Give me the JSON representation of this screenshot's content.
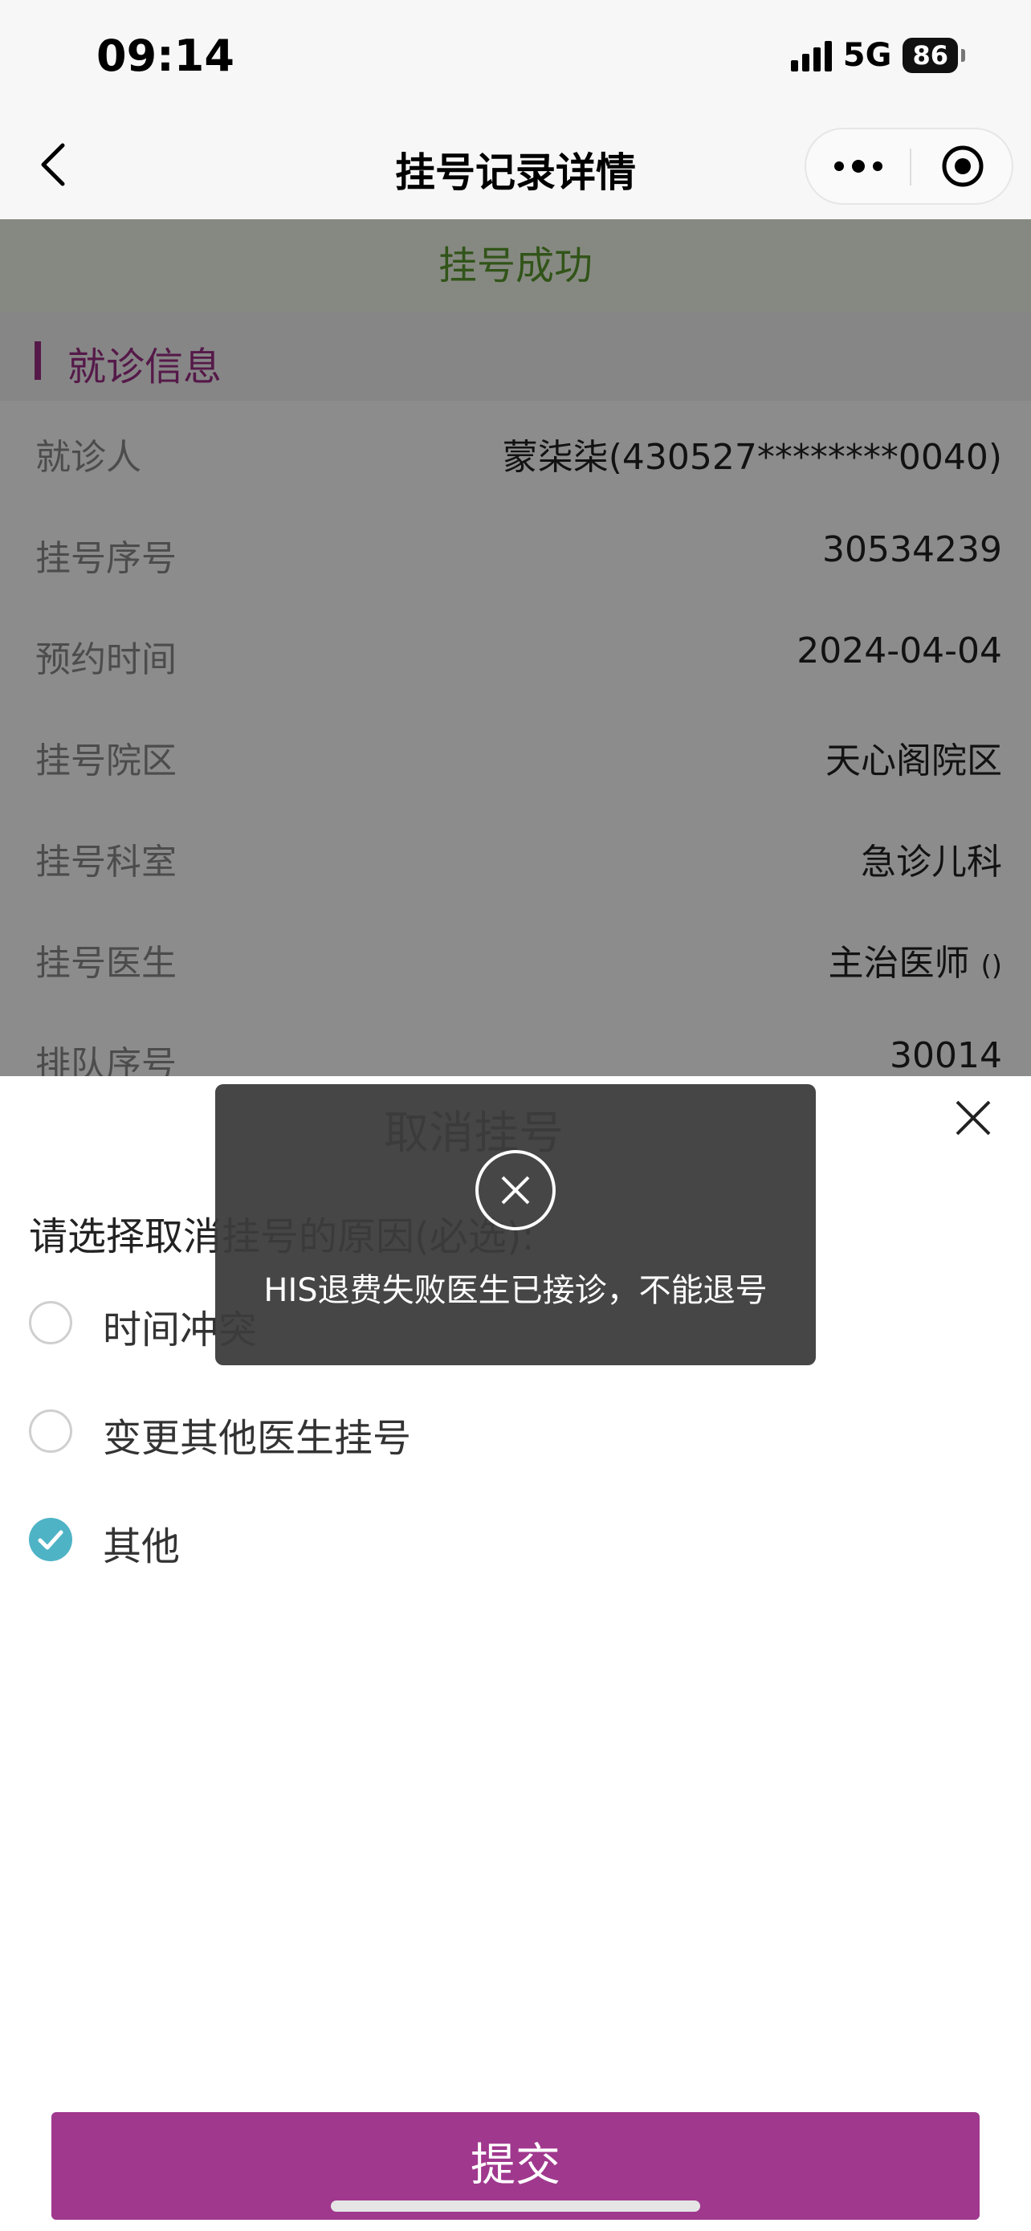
{
  "status_bar": {
    "time": "09:14",
    "network": "5G",
    "battery": "86"
  },
  "nav": {
    "title": "挂号记录详情"
  },
  "detail": {
    "status": "挂号成功",
    "section_title": "就诊信息",
    "rows": [
      {
        "label": "就诊人",
        "value": "蒙柒柒(430527********0040)"
      },
      {
        "label": "挂号序号",
        "value": "30534239"
      },
      {
        "label": "预约时间",
        "value": "2024-04-04"
      },
      {
        "label": "挂号院区",
        "value": "天心阁院区"
      },
      {
        "label": "挂号科室",
        "value": "急诊儿科"
      },
      {
        "label": "挂号医生",
        "value": "主治医师",
        "extra": "()"
      },
      {
        "label": "排队序号",
        "value": "30014"
      }
    ]
  },
  "cancel_sheet": {
    "title": "取消挂号",
    "reason_label": "请选择取消挂号的原因(必选):",
    "options": [
      {
        "label": "时间冲突",
        "checked": false
      },
      {
        "label": "变更其他医生挂号",
        "checked": false
      },
      {
        "label": "其他",
        "checked": true
      }
    ],
    "submit_label": "提交"
  },
  "toast": {
    "message": "HIS退费失败医生已接诊，不能退号"
  },
  "colors": {
    "accent": "#a0388e",
    "success": "#5a9a2e",
    "check": "#4fb3c6"
  }
}
